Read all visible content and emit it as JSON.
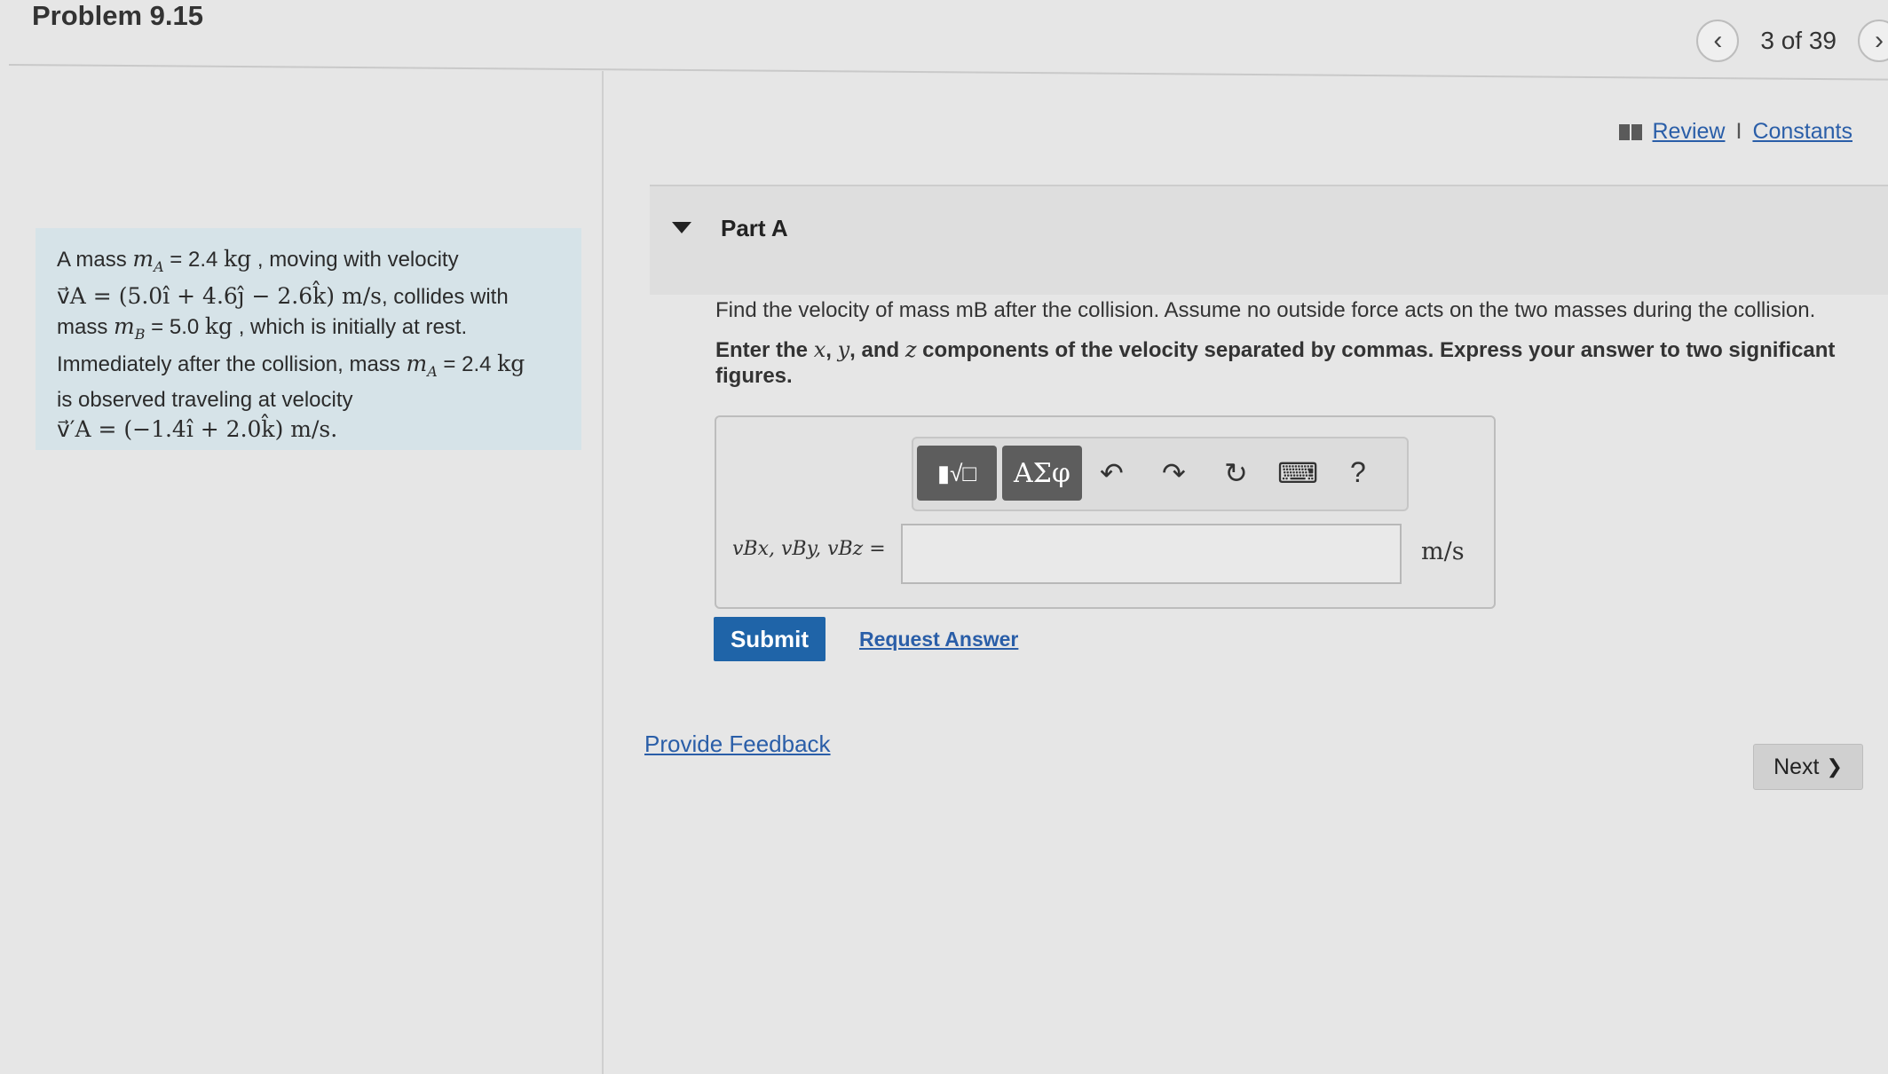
{
  "header": {
    "title": "Problem 9.15",
    "counter": "3 of 39",
    "prev_icon": "chevron-left-icon",
    "next_icon": "chevron-right-icon"
  },
  "links": {
    "review": "Review",
    "separator": "I",
    "constants": "Constants"
  },
  "problem": {
    "l1a": "A mass ",
    "l1m": "m",
    "l1sub": "A",
    "l1b": " = 2.4 ",
    "l1kg": "kg",
    "l1c": " , moving with velocity",
    "l2eq": "v⃗A = (5.0î + 4.6ĵ − 2.6k̂) m/s",
    "l2c": ", collides with",
    "l3a": "mass ",
    "l3m": "m",
    "l3sub": "B",
    "l3b": " = 5.0 ",
    "l3kg": "kg",
    "l3c": " , which is initially at rest.",
    "l4a": "Immediately after the collision, mass ",
    "l4m": "m",
    "l4sub": "A",
    "l4b": " = 2.4 ",
    "l4kg": "kg",
    "l5": "is observed traveling at velocity",
    "l6eq": "v⃗′A = (−1.4î + 2.0k̂) m/s."
  },
  "part": {
    "label": "Part A",
    "question": "Find the velocity of mass mB after the collision. Assume no outside force acts on the two masses during the collision.",
    "instr1": "Enter the ",
    "vx": "x",
    "c1": ", ",
    "vy": "y",
    "c2": ", and ",
    "vz": "z",
    "instr2": " components of the velocity separated by commas. Express your answer to two significant figures."
  },
  "answer": {
    "label": "vBx, vBy, vBz =",
    "value": "",
    "unit": "m/s"
  },
  "toolbar": {
    "template_btn": "▮√□",
    "symbols_btn": "ΑΣφ",
    "undo": "↶",
    "redo": "↷",
    "reset": "↻",
    "keyboard": "⌨",
    "help": "?"
  },
  "actions": {
    "submit": "Submit",
    "request": "Request Answer",
    "feedback": "Provide Feedback",
    "next": "Next",
    "next_chevron": "❯"
  }
}
